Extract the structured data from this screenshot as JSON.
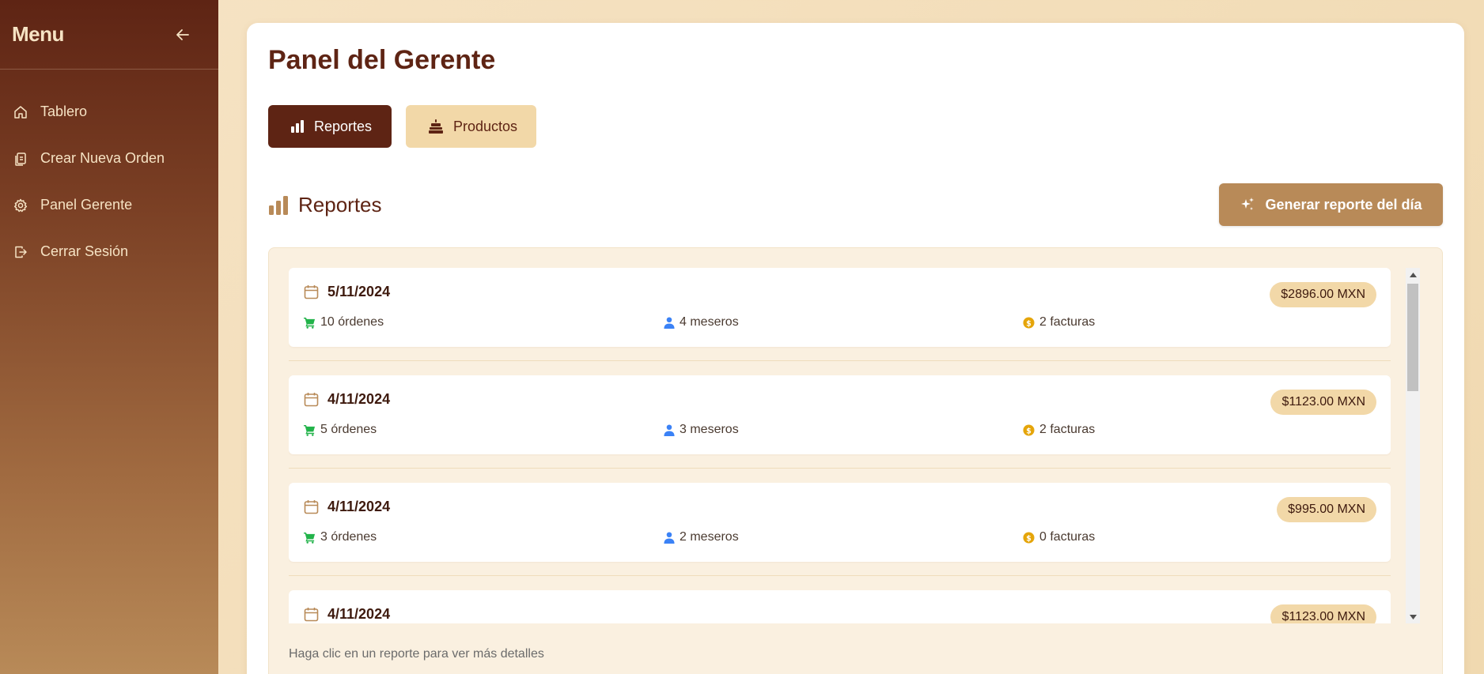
{
  "sidebar": {
    "title": "Menu",
    "items": [
      {
        "label": "Tablero",
        "icon": "home-icon"
      },
      {
        "label": "Crear Nueva Orden",
        "icon": "clipboard-icon"
      },
      {
        "label": "Panel Gerente",
        "icon": "gear-icon"
      },
      {
        "label": "Cerrar Sesión",
        "icon": "logout-icon"
      }
    ]
  },
  "main": {
    "title": "Panel del Gerente",
    "tabs": [
      {
        "label": "Reportes",
        "icon": "bar-chart-icon",
        "active": true
      },
      {
        "label": "Productos",
        "icon": "cake-icon",
        "active": false
      }
    ],
    "section_title": "Reportes",
    "generate_button": "Generar reporte del día",
    "reports": [
      {
        "date": "5/11/2024",
        "total": "$2896.00 MXN",
        "orders": "10 órdenes",
        "waiters": "4 meseros",
        "invoices": "2 facturas"
      },
      {
        "date": "4/11/2024",
        "total": "$1123.00 MXN",
        "orders": "5 órdenes",
        "waiters": "3 meseros",
        "invoices": "2 facturas"
      },
      {
        "date": "4/11/2024",
        "total": "$995.00 MXN",
        "orders": "3 órdenes",
        "waiters": "2 meseros",
        "invoices": "0 facturas"
      },
      {
        "date": "4/11/2024",
        "total": "$1123.00 MXN",
        "orders": "",
        "waiters": "",
        "invoices": ""
      }
    ],
    "hint": "Haga clic en un reporte para ver más detalles"
  },
  "colors": {
    "brand_dark": "#5e2414",
    "accent_tan": "#b88a58",
    "badge_bg": "#f2d8a8",
    "cart_green": "#22b34a",
    "user_blue": "#3b82f6",
    "coin_gold": "#e5a50a"
  }
}
